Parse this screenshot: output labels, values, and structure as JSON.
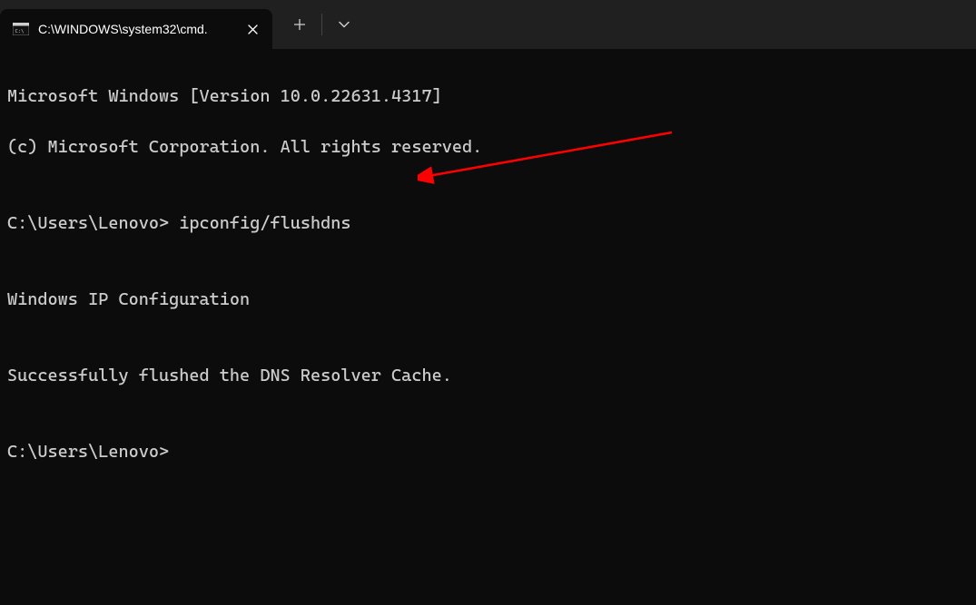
{
  "tab": {
    "title": "C:\\WINDOWS\\system32\\cmd."
  },
  "terminal": {
    "line1": "Microsoft Windows [Version 10.0.22631.4317]",
    "line2": "(c) Microsoft Corporation. All rights reserved.",
    "blank1": "",
    "prompt1": "C:\\Users\\Lenovo> ipconfig/flushdns",
    "blank2": "",
    "line3": "Windows IP Configuration",
    "blank3": "",
    "line4": "Successfully flushed the DNS Resolver Cache.",
    "blank4": "",
    "prompt2": "C:\\Users\\Lenovo>"
  }
}
